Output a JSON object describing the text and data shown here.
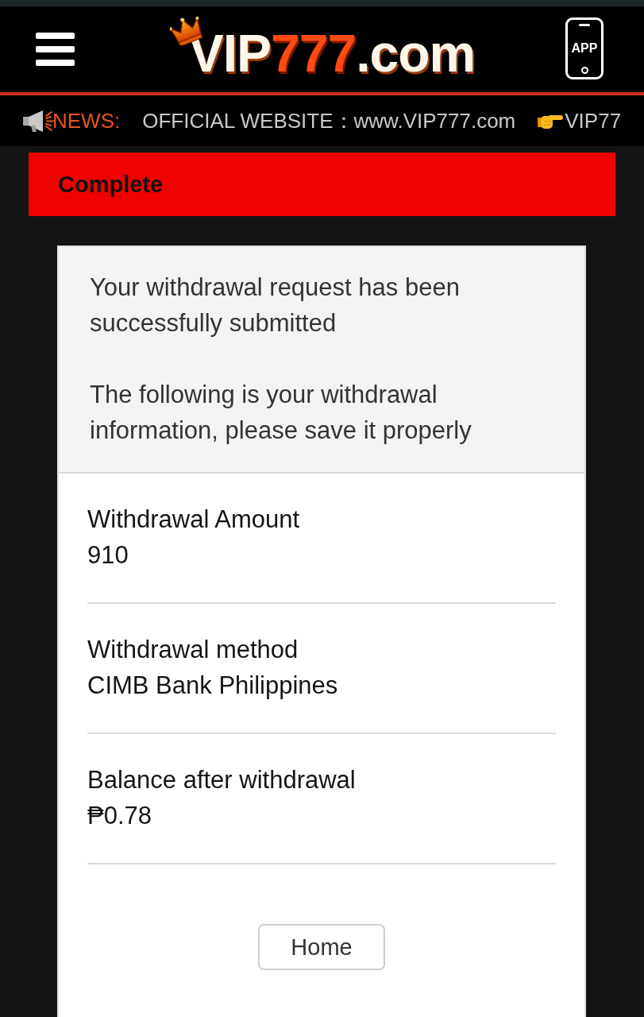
{
  "header": {
    "logo": {
      "segments": [
        {
          "text": "VIP",
          "kind": "plain"
        },
        {
          "text": "777",
          "kind": "accent"
        },
        {
          "text": ".com",
          "kind": "plain"
        }
      ]
    },
    "app_button": {
      "label": "APP"
    }
  },
  "news": {
    "label": "NEWS:",
    "items": [
      {
        "text": "OFFICIAL WEBSITE：www.VIP777.com",
        "kind": "plain"
      },
      {
        "text": "VIP77",
        "kind": "pointer"
      }
    ]
  },
  "status_banner": {
    "title": "Complete"
  },
  "message": {
    "paragraphs": [
      "Your withdrawal request has been successfully submitted",
      "The following is your withdrawal information, please save it properly"
    ]
  },
  "details": [
    {
      "label": "Withdrawal Amount",
      "value": "910"
    },
    {
      "label": "Withdrawal method",
      "value": "CIMB Bank Philippines"
    },
    {
      "label": "Balance after withdrawal",
      "value": "₱0.78"
    }
  ],
  "buttons": [
    {
      "label": "Home"
    }
  ]
}
